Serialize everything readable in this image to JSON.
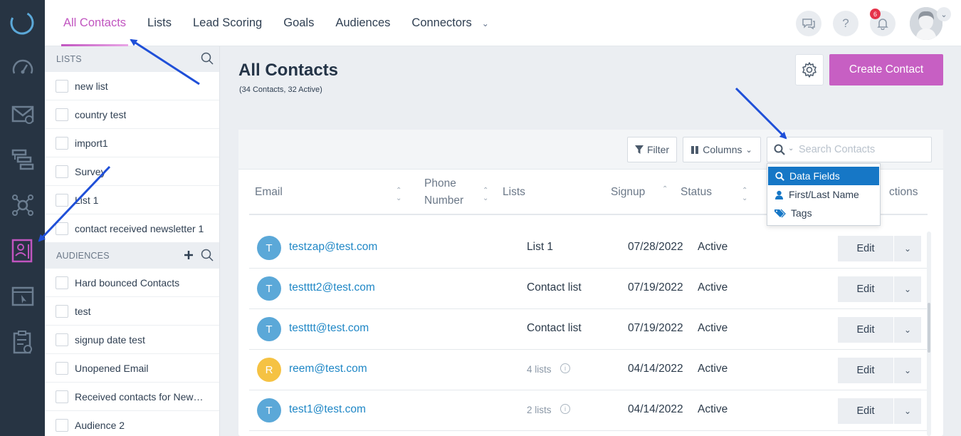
{
  "topnav": {
    "tabs": [
      {
        "label": "All Contacts"
      },
      {
        "label": "Lists"
      },
      {
        "label": "Lead Scoring"
      },
      {
        "label": "Goals"
      },
      {
        "label": "Audiences"
      },
      {
        "label": "Connectors"
      }
    ],
    "notification_count": "6",
    "help_label": "?"
  },
  "sidebar": {
    "lists_header": "LISTS",
    "lists": [
      "new list",
      "country test",
      "import1",
      "Survey",
      "List 1",
      "contact received newsletter 1"
    ],
    "audiences_header": "AUDIENCES",
    "audiences": [
      "Hard bounced Contacts",
      "test",
      "signup date test",
      "Unopened Email",
      "Received contacts for New…",
      "Audience 2"
    ]
  },
  "main": {
    "title": "All Contacts",
    "subtitle": "(34 Contacts, 32 Active)",
    "create_button": "Create Contact"
  },
  "toolbar": {
    "filter_label": "Filter",
    "columns_label": "Columns",
    "search_placeholder": "Search Contacts"
  },
  "search_dropdown": {
    "items": [
      "Data Fields",
      "First/Last Name",
      "Tags"
    ]
  },
  "table": {
    "headers": {
      "email": "Email",
      "phone_line1": "Phone",
      "phone_line2": "Number",
      "lists": "Lists",
      "signup": "Signup",
      "status": "Status",
      "actions": "ctions"
    },
    "rows": [
      {
        "initial": "T",
        "avatar_color": "#5ba8d8",
        "email": "testzap@test.com",
        "lists": "List 1",
        "lists_muted": false,
        "signup": "07/28/2022",
        "status": "Active",
        "edit": "Edit"
      },
      {
        "initial": "T",
        "avatar_color": "#5ba8d8",
        "email": "testttt2@test.com",
        "lists": "Contact list",
        "lists_muted": false,
        "signup": "07/19/2022",
        "status": "Active",
        "edit": "Edit"
      },
      {
        "initial": "T",
        "avatar_color": "#5ba8d8",
        "email": "testttt@test.com",
        "lists": "Contact list",
        "lists_muted": false,
        "signup": "07/19/2022",
        "status": "Active",
        "edit": "Edit"
      },
      {
        "initial": "R",
        "avatar_color": "#f5c243",
        "email": "reem@test.com",
        "lists": "4 lists",
        "lists_muted": true,
        "signup": "04/14/2022",
        "status": "Active",
        "edit": "Edit"
      },
      {
        "initial": "T",
        "avatar_color": "#5ba8d8",
        "email": "test1@test.com",
        "lists": "2 lists",
        "lists_muted": true,
        "signup": "04/14/2022",
        "status": "Active",
        "edit": "Edit"
      }
    ]
  },
  "colors": {
    "accent": "#c155c0",
    "rail": "#273443",
    "link": "#1f87c6",
    "annotation_arrow": "#1f4fd8"
  }
}
